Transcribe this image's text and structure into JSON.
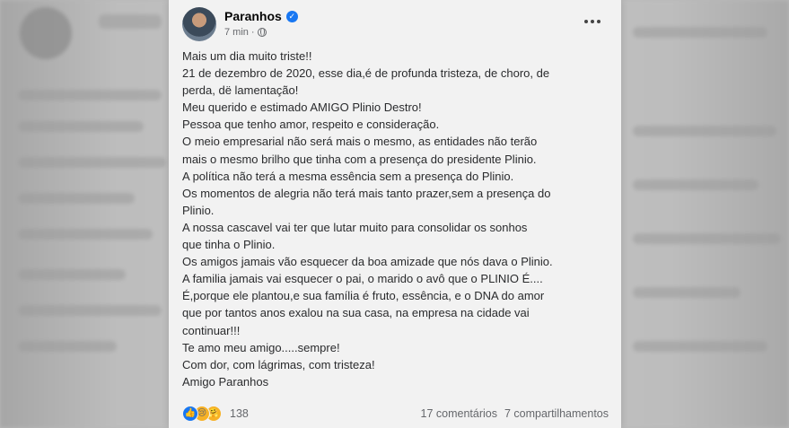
{
  "post": {
    "author": "Paranhos",
    "time": "7 min",
    "separator": "·",
    "lines": [
      "Mais um dia muito triste!!",
      "21 de dezembro de 2020, esse dia,é de profunda tristeza, de choro, de",
      "perda, dë lamentação!",
      "Meu querido e estimado AMIGO Plinio Destro!",
      "Pessoa que tenho amor, respeito e consideração.",
      "O meio empresarial não será mais o mesmo, as entidades não terão",
      "mais o mesmo brilho que tinha com a presença do presidente Plinio.",
      "A política não terá a mesma essência sem a presença do Plinio.",
      "Os momentos de alegria não terá mais tanto prazer,sem a presença do",
      "Plinio.",
      "A nossa cascavel vai ter que lutar muito para consolidar os sonhos",
      "que tinha o Plinio.",
      "Os amigos jamais vão esquecer da boa amizade que nós dava o Plinio.",
      "A familia jamais vai esquecer o pai, o marido o avô que o PLINIO É....",
      "É,porque ele plantou,e sua família é fruto, essência, e o DNA do amor",
      "que por tantos anos exalou na sua casa, na empresa na cidade vai",
      "continuar!!!",
      "Te amo meu amigo.....sempre!",
      "Com dor, com lágrimas, com tristeza!",
      "Amigo Paranhos"
    ]
  },
  "footer": {
    "reaction_count": "138",
    "comments": "17 comentários",
    "shares": "7 compartilhamentos"
  },
  "icons": {
    "verified": "verified-badge-icon",
    "audience": "globe-icon",
    "more": "more-options-icon",
    "reactions": [
      "like-icon",
      "sad-icon",
      "care-icon"
    ]
  },
  "colors": {
    "verified": "#1877f2",
    "like": "#1877f2",
    "sad": "#f7b125",
    "secondary_text": "#65676b"
  }
}
